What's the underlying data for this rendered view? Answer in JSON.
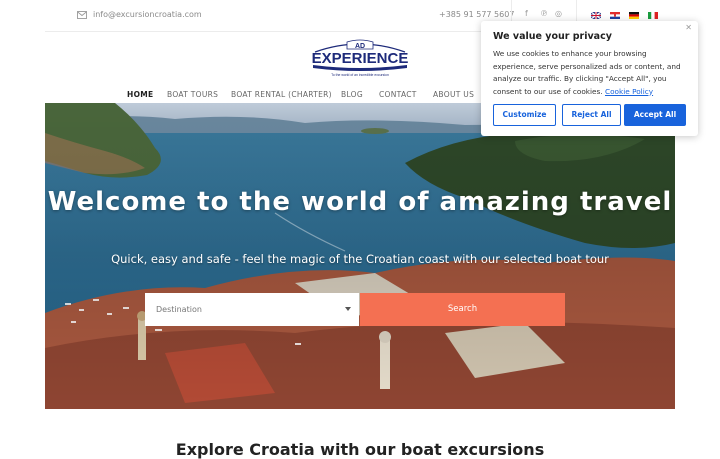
{
  "topbar": {
    "email": "info@excursioncroatia.com",
    "phone": "+385 91 577 5607",
    "social_icons": [
      "facebook-icon",
      "pinterest-icon",
      "instagram-icon"
    ],
    "languages": [
      "english-flag",
      "croatian-flag",
      "german-flag",
      "italian-flag"
    ]
  },
  "logo": {
    "top": "AD",
    "main": "EXPERIENCE",
    "tagline": "To the world of an incredible excursion"
  },
  "nav": {
    "items": [
      {
        "label": "HOME",
        "active": true
      },
      {
        "label": "BOAT TOURS",
        "active": false
      },
      {
        "label": "BOAT RENTAL (CHARTER)",
        "active": false
      },
      {
        "label": "BLOG",
        "active": false
      },
      {
        "label": "CONTACT",
        "active": false
      },
      {
        "label": "ABOUT US",
        "active": false
      }
    ]
  },
  "hero": {
    "title": "Welcome to the world of amazing travel",
    "subtitle": "Quick, easy and safe - feel the magic of the Croatian coast with our selected boat tour",
    "destination_placeholder": "Destination",
    "search_label": "Search"
  },
  "cookie": {
    "title": "We value your privacy",
    "text": "We use cookies to enhance your browsing experience, serve personalized ads or content, and analyze our traffic. By clicking \"Accept All\", you consent to our use of cookies.",
    "policy_link": "Cookie Policy",
    "customize": "Customize",
    "reject": "Reject All",
    "accept": "Accept All"
  },
  "below_heading": "Explore Croatia with our boat excursions",
  "colors": {
    "accent": "#f47052",
    "cookie_blue": "#1863dc",
    "logo_navy": "#1d2a7a"
  }
}
